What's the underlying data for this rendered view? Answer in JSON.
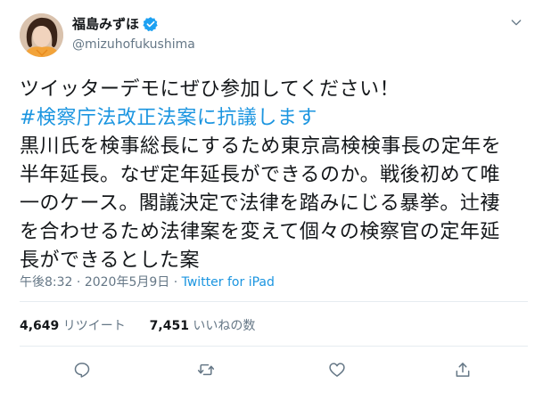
{
  "user": {
    "display_name": "福島みずほ",
    "handle": "@mizuhofukushima",
    "verified": true
  },
  "tweet": {
    "lines": [
      "ツイッターデモにぜひ参加してください！",
      "#検察庁法改正法案に抗議します",
      "黒川氏を検事総長にするため東京高検検事長の定年を",
      "半年延長。なぜ定年延長ができるのか。戦後初めて唯",
      "一のケース。閣議決定で法律を踏みにじる暴挙。辻褄",
      "を合わせるため法律案を変えて個々の検察官の定年延",
      "長ができるとした案"
    ],
    "time": "午後8:32",
    "separator": " · ",
    "date": "2020年5月9日",
    "source": "Twitter for iPad"
  },
  "stats": {
    "retweets_count": "4,649",
    "retweets_label": "リツイート",
    "likes_count": "7,451",
    "likes_label": "いいねの数"
  },
  "colors": {
    "link": "#1b95e0",
    "secondary_text": "#657786",
    "primary_text": "#14171a",
    "divider": "#e6ecf0",
    "verified_badge": "#1da1f2"
  },
  "icons": [
    "more-chevron-icon",
    "verified-badge-icon",
    "reply-icon",
    "retweet-icon",
    "like-icon",
    "share-icon"
  ]
}
